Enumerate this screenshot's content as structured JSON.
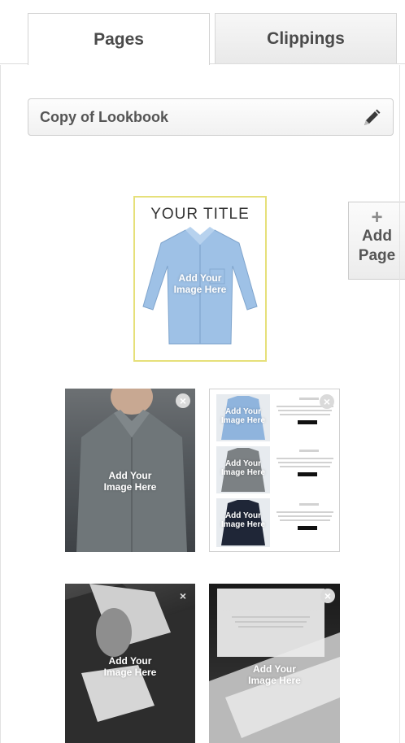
{
  "tabs": {
    "pages": "Pages",
    "clippings": "Clippings"
  },
  "title_field": {
    "value": "Copy of Lookbook"
  },
  "add_page": {
    "plus": "+",
    "line1": "Add",
    "line2": "Page"
  },
  "thumbnails": {
    "cover": {
      "title": "YOUR TITLE",
      "placeholder_line1": "Add Your",
      "placeholder_line2": "Image Here"
    },
    "page2": {
      "placeholder_line1": "Add Your",
      "placeholder_line2": "Image Here",
      "close": "×"
    },
    "page3": {
      "rows": [
        {
          "placeholder_line1": "Add Your",
          "placeholder_line2": "Image Here"
        },
        {
          "placeholder_line1": "Add Your",
          "placeholder_line2": "Image Here"
        },
        {
          "placeholder_line1": "Add Your",
          "placeholder_line2": "Image Here"
        }
      ],
      "close": "×"
    },
    "page4": {
      "placeholder_line1": "Add Your",
      "placeholder_line2": "Image Here",
      "close": "×"
    },
    "page5": {
      "placeholder_line1": "Add Your",
      "placeholder_line2": "Image Here",
      "close": "×"
    }
  }
}
